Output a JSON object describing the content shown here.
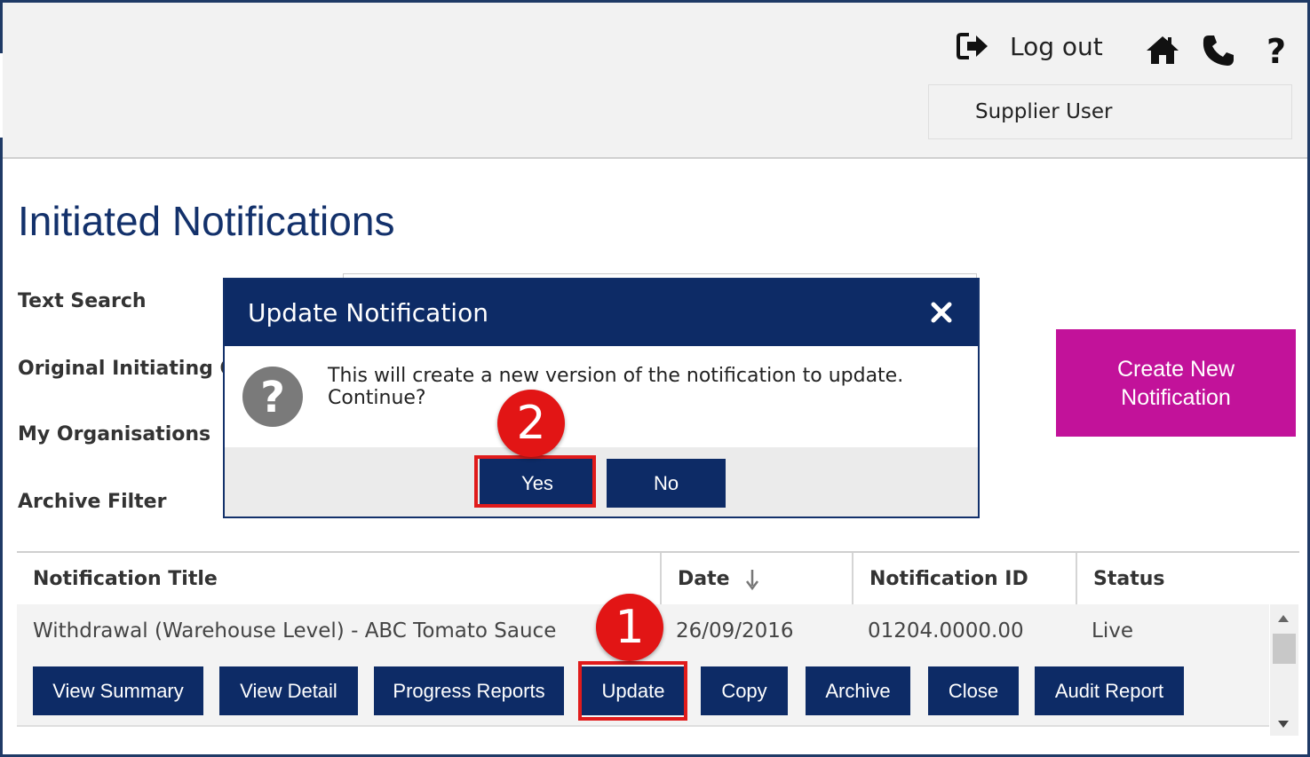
{
  "header": {
    "logout_label": "Log out",
    "user_label": "Supplier User",
    "icons": [
      "logout-icon",
      "home-icon",
      "phone-icon",
      "help-icon"
    ]
  },
  "page": {
    "title": "Initiated Notifications",
    "filters": {
      "text_search": "Text Search",
      "original_initiating_org": "Original Initiating Org",
      "my_organisations": "My Organisations",
      "archive_filter": "Archive Filter"
    },
    "create_button": [
      "Create New",
      "Notification"
    ]
  },
  "table": {
    "columns": [
      "Notification Title",
      "Date",
      "Notification ID",
      "Status"
    ],
    "rows": [
      {
        "title": "Withdrawal (Warehouse Level) - ABC Tomato Sauce",
        "date": "26/09/2016",
        "id": "01204.0000.00",
        "status": "Live",
        "actions": [
          "View Summary",
          "View Detail",
          "Progress Reports",
          "Update",
          "Copy",
          "Archive",
          "Close",
          "Audit Report"
        ]
      }
    ]
  },
  "dialog": {
    "title": "Update Notification",
    "message": "This will create a new version of the notification to update. Continue?",
    "yes_label": "Yes",
    "no_label": "No"
  },
  "annotations": {
    "step1": "1",
    "step2": "2"
  },
  "colors": {
    "navy": "#0d2b66",
    "title_blue": "#13316b",
    "magenta": "#c2129a",
    "highlight_red": "#e01b1b"
  }
}
